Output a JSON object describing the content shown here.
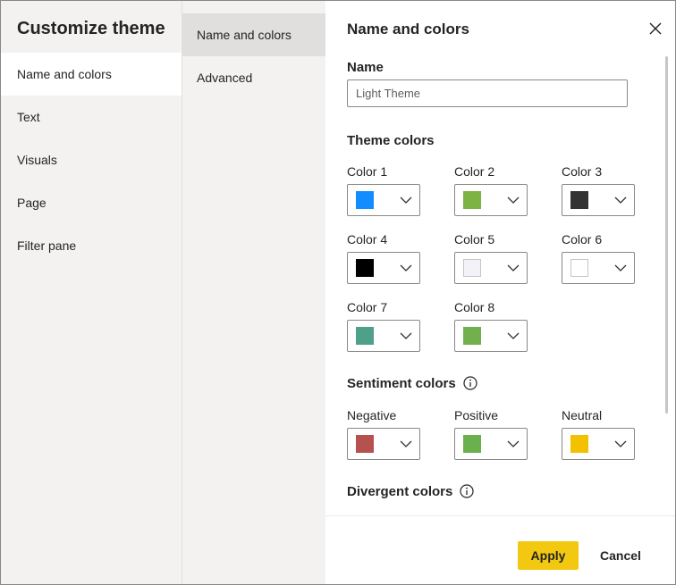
{
  "dialog": {
    "title": "Customize theme"
  },
  "nav_primary": [
    {
      "label": "Name and colors"
    },
    {
      "label": "Text"
    },
    {
      "label": "Visuals"
    },
    {
      "label": "Page"
    },
    {
      "label": "Filter pane"
    }
  ],
  "nav_secondary": [
    {
      "label": "Name and colors"
    },
    {
      "label": "Advanced"
    }
  ],
  "panel": {
    "title": "Name and colors",
    "name_label": "Name",
    "name_value": "Light Theme",
    "theme_colors_heading": "Theme colors",
    "theme_colors": [
      {
        "label": "Color 1",
        "hex": "#118dff"
      },
      {
        "label": "Color 2",
        "hex": "#7cb342"
      },
      {
        "label": "Color 3",
        "hex": "#333333"
      },
      {
        "label": "Color 4",
        "hex": "#000000"
      },
      {
        "label": "Color 5",
        "hex": "#f3f2f8"
      },
      {
        "label": "Color 6",
        "hex": "#ffffff"
      },
      {
        "label": "Color 7",
        "hex": "#4ea08a"
      },
      {
        "label": "Color 8",
        "hex": "#72b04e"
      }
    ],
    "sentiment_heading": "Sentiment colors",
    "sentiment_colors": [
      {
        "label": "Negative",
        "hex": "#b5514f"
      },
      {
        "label": "Positive",
        "hex": "#6ab04c"
      },
      {
        "label": "Neutral",
        "hex": "#f2c200"
      }
    ],
    "divergent_heading": "Divergent colors"
  },
  "footer": {
    "apply_label": "Apply",
    "cancel_label": "Cancel"
  },
  "colors": {
    "accent": "#f2c811",
    "nav_bg": "#f3f2f1",
    "selected_bg": "#e1dfdd"
  },
  "icons": {
    "close": "close-icon",
    "info": "info-icon",
    "chevron": "chevron-down-icon"
  }
}
